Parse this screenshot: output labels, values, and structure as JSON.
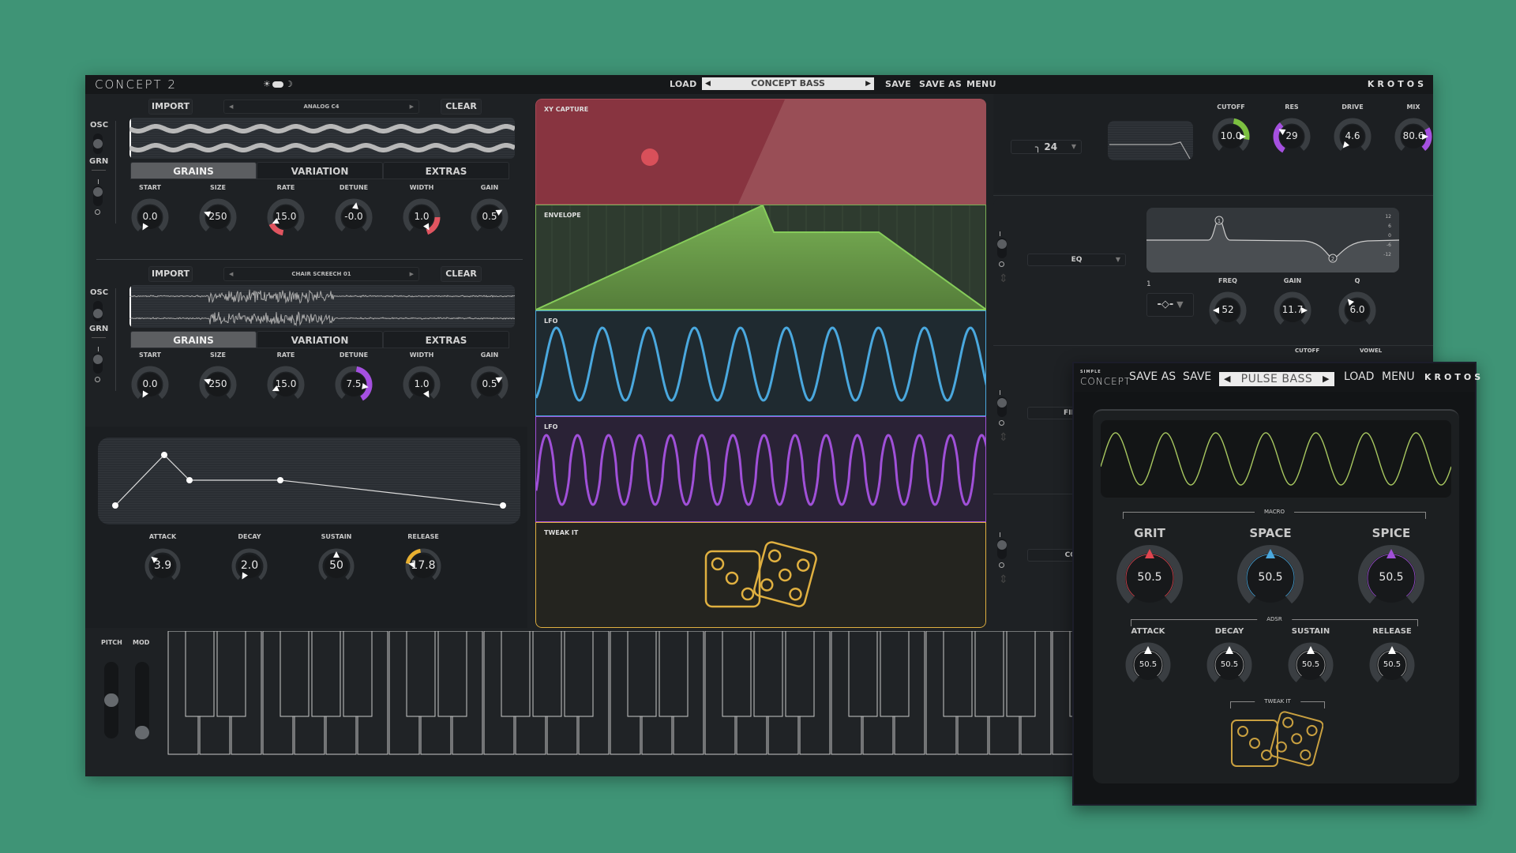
{
  "app": {
    "logo": "CONCEPT 2",
    "theme_toggle": {
      "light_icon": "☀",
      "dark_icon": "☽",
      "mode": "dark"
    },
    "topbar": {
      "load": "LOAD",
      "preset": "CONCEPT BASS",
      "save": "SAVE",
      "save_as": "SAVE AS",
      "menu": "MENU",
      "brand": "KROTOS"
    }
  },
  "oscillators": [
    {
      "import": "IMPORT",
      "sample": "ANALOG C4",
      "clear": "CLEAR",
      "mode_top": "OSC",
      "mode_bottom": "GRN",
      "tabs": [
        "GRAINS",
        "VARIATION",
        "EXTRAS"
      ],
      "active_tab": "GRAINS",
      "knobs": [
        {
          "label": "START",
          "value": "0.0"
        },
        {
          "label": "SIZE",
          "value": "250"
        },
        {
          "label": "RATE",
          "value": "15.0",
          "mod_color": "#e05560"
        },
        {
          "label": "DETUNE",
          "value": "-0.0"
        },
        {
          "label": "WIDTH",
          "value": "1.0",
          "mod_color": "#e05560"
        },
        {
          "label": "GAIN",
          "value": "0.5"
        }
      ]
    },
    {
      "import": "IMPORT",
      "sample": "CHAIR SCREECH 01",
      "clear": "CLEAR",
      "mode_top": "OSC",
      "mode_bottom": "GRN",
      "tabs": [
        "GRAINS",
        "VARIATION",
        "EXTRAS"
      ],
      "active_tab": "GRAINS",
      "knobs": [
        {
          "label": "START",
          "value": "0.0"
        },
        {
          "label": "SIZE",
          "value": "250"
        },
        {
          "label": "RATE",
          "value": "15.0"
        },
        {
          "label": "DETUNE",
          "value": "7.5",
          "mod_color": "#a550e0"
        },
        {
          "label": "WIDTH",
          "value": "1.0"
        },
        {
          "label": "GAIN",
          "value": "0.5"
        }
      ]
    }
  ],
  "amp_envelope": {
    "knobs": [
      {
        "label": "ATTACK",
        "value": "3.9"
      },
      {
        "label": "DECAY",
        "value": "2.0"
      },
      {
        "label": "SUSTAIN",
        "value": "50"
      },
      {
        "label": "RELEASE",
        "value": "17.8",
        "mod_color": "#e8b030"
      }
    ]
  },
  "mod_panels": [
    {
      "title": "XY CAPTURE",
      "color": "#8a3540"
    },
    {
      "title": "ENVELOPE",
      "color": "#7ab055"
    },
    {
      "title": "LFO",
      "color": "#4aa8de"
    },
    {
      "title": "LFO",
      "color": "#a050d8"
    },
    {
      "title": "TWEAK IT",
      "color": "#e0b040"
    }
  ],
  "filter": {
    "slope": "24",
    "knobs": [
      {
        "label": "CUTOFF",
        "value": "10.0"
      },
      {
        "label": "RES",
        "value": "29"
      },
      {
        "label": "DRIVE",
        "value": "4.6"
      },
      {
        "label": "MIX",
        "value": "80.6"
      }
    ]
  },
  "fx_slots": [
    {
      "type": "EQ",
      "band": "1",
      "scale": [
        "12",
        "6",
        "0",
        "-6",
        "-12"
      ],
      "knobs": [
        {
          "label": "FREQ",
          "value": "52"
        },
        {
          "label": "GAIN",
          "value": "11.7"
        },
        {
          "label": "Q",
          "value": "6.0"
        }
      ]
    },
    {
      "type": "FILTER",
      "labels": [
        "CUTOFF",
        "VOWEL"
      ]
    },
    {
      "type": "COMP"
    }
  ],
  "keyboard": {
    "pitch": "PITCH",
    "mod": "MOD"
  },
  "simple": {
    "logo_small": "SIMPLE",
    "logo": "CONCEPT",
    "save_as": "SAVE AS",
    "save": "SAVE",
    "preset": "PULSE BASS",
    "load": "LOAD",
    "menu": "MENU",
    "brand": "KROTOS",
    "macro_title": "MACRO",
    "macros": [
      {
        "label": "GRIT",
        "value": "50.5",
        "color": "#e0454f"
      },
      {
        "label": "SPACE",
        "value": "50.5",
        "color": "#4aa8de"
      },
      {
        "label": "SPICE",
        "value": "50.5",
        "color": "#a050d8"
      }
    ],
    "adsr_title": "ADSR",
    "adsr": [
      {
        "label": "ATTACK",
        "value": "50.5"
      },
      {
        "label": "DECAY",
        "value": "50.5"
      },
      {
        "label": "SUSTAIN",
        "value": "50.5"
      },
      {
        "label": "RELEASE",
        "value": "50.5"
      }
    ],
    "tweak_title": "TWEAK IT"
  }
}
